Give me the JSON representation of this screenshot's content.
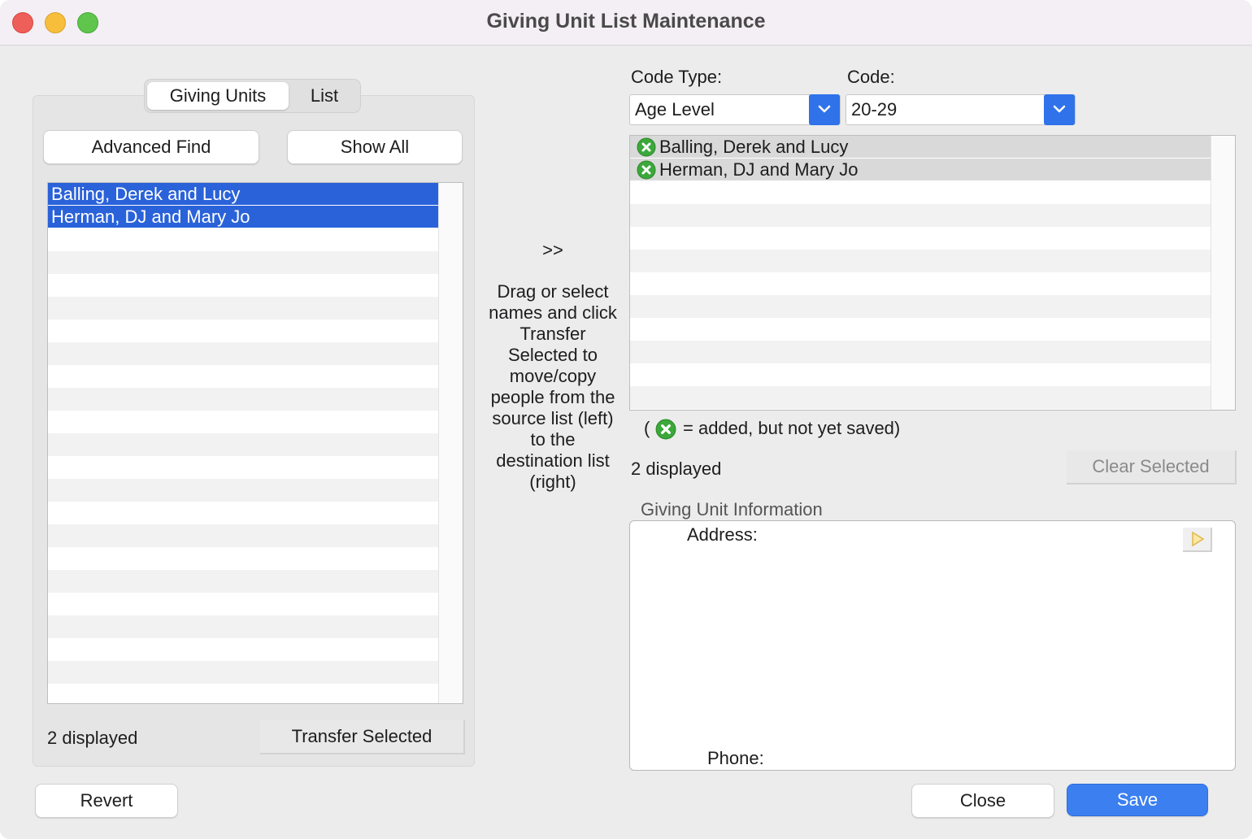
{
  "window": {
    "title": "Giving Unit List Maintenance"
  },
  "left": {
    "tabs": [
      "Giving Units",
      "List"
    ],
    "advanced_find_label": "Advanced Find",
    "show_all_label": "Show All",
    "items": [
      "Balling, Derek and Lucy",
      "Herman, DJ and Mary Jo"
    ],
    "count_label": "2 displayed",
    "transfer_label": "Transfer Selected"
  },
  "middle": {
    "arrow_label": ">>",
    "instructions": "Drag or select names and click Transfer Selected to move/copy people from the source list (left) to the destination list (right)"
  },
  "right": {
    "code_type_label": "Code Type:",
    "code_label": "Code:",
    "code_type_value": "Age Level",
    "code_value": "20-29",
    "items": [
      "Balling, Derek and Lucy",
      "Herman, DJ and Mary Jo"
    ],
    "legend_open": "(",
    "legend_text": "= added, but not yet saved)",
    "count_label": "2 displayed",
    "clear_selected_label": "Clear Selected",
    "info_section_label": "Giving Unit Information",
    "address_label": "Address:",
    "phone_label": "Phone:"
  },
  "footer": {
    "revert_label": "Revert",
    "close_label": "Close",
    "save_label": "Save"
  },
  "colors": {
    "selection": "#2a62d9",
    "primary_button": "#3b7ff0",
    "added_icon": "#3ca73a"
  },
  "icons": {
    "added": "green-x-circle-icon",
    "dropdown": "chevron-down-icon",
    "play": "play-triangle-icon"
  }
}
